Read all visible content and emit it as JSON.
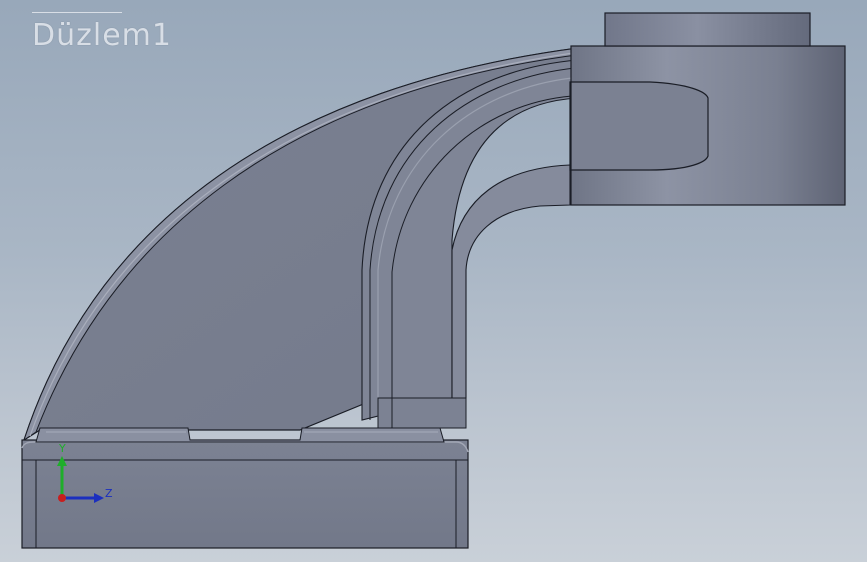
{
  "viewport": {
    "plane_label": "Düzlem1"
  },
  "triad": {
    "y_label": "Y",
    "z_label": "Z",
    "colors": {
      "y_axis": "#1fae2a",
      "z_axis": "#1b2fbf",
      "origin": "#c81e1e"
    }
  },
  "model": {
    "colors": {
      "face_main": "#787e8f",
      "face_dark": "#6a7081",
      "face_light": "#8a90a1",
      "edge": "#1a1d26",
      "highlight": "#a7acba"
    }
  }
}
